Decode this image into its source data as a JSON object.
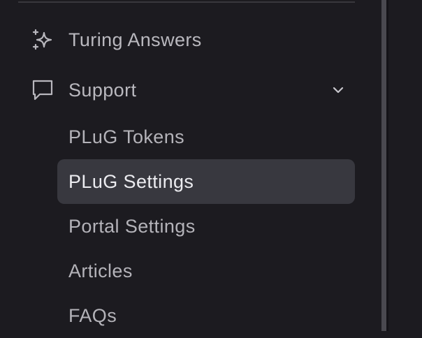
{
  "sidebar": {
    "items": [
      {
        "label": "Turing Answers",
        "icon": "sparkles-icon"
      },
      {
        "label": "Support",
        "icon": "chat-bubble-icon",
        "expanded": true
      }
    ],
    "support_children": [
      {
        "label": "PLuG Tokens",
        "active": false
      },
      {
        "label": "PLuG Settings",
        "active": true
      },
      {
        "label": "Portal Settings",
        "active": false
      },
      {
        "label": "Articles",
        "active": false
      },
      {
        "label": "FAQs",
        "active": false
      }
    ]
  },
  "colors": {
    "background": "#1c1b20",
    "active_item_bg": "#38383f",
    "text_muted": "#b8b7bd",
    "text_active": "#ececf0"
  }
}
